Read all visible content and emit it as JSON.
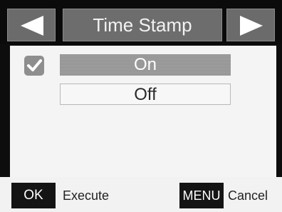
{
  "header": {
    "title": "Time Stamp",
    "prev_icon": "triangle-left-icon",
    "next_icon": "triangle-right-icon"
  },
  "options": {
    "checkbox_icon": "checkmark-icon",
    "checkbox_checked": true,
    "items": [
      {
        "label": "On",
        "selected": true
      },
      {
        "label": "Off",
        "selected": false
      }
    ]
  },
  "footer": {
    "ok_key": "OK",
    "ok_action": "Execute",
    "menu_key": "MENU",
    "menu_action": "Cancel"
  },
  "colors": {
    "selected_bg": "#9a9a9a",
    "header_bg": "#6d6d6d",
    "panel_bg": "#f4f4f4"
  }
}
